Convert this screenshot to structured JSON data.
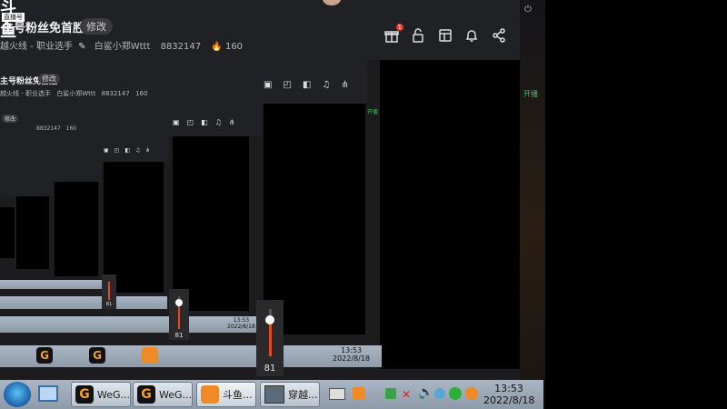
{
  "stream": {
    "logo_top": "斗鱼",
    "logo_badge": "直播号",
    "title": "主号粉丝免首胜",
    "edit_label": "修改",
    "category": "越火线 - 职业选手",
    "streamer": "白鲨小郑Wttt",
    "room_id": "8832147",
    "heat": "160"
  },
  "toolbar_icons": [
    "gift-icon",
    "unlock-icon",
    "layout-icon",
    "bell-icon",
    "share-icon"
  ],
  "gift_badge": "1",
  "volume": {
    "value": "81",
    "level": 0.81
  },
  "taskbar": {
    "items": [
      {
        "label": "WeG..."
      },
      {
        "label": "WeG..."
      },
      {
        "label": "斗鱼..."
      },
      {
        "label": "穿越..."
      }
    ],
    "clock_time": "13:53",
    "clock_date": "2022/8/18"
  },
  "side_labels": {
    "green_top": "开播"
  }
}
